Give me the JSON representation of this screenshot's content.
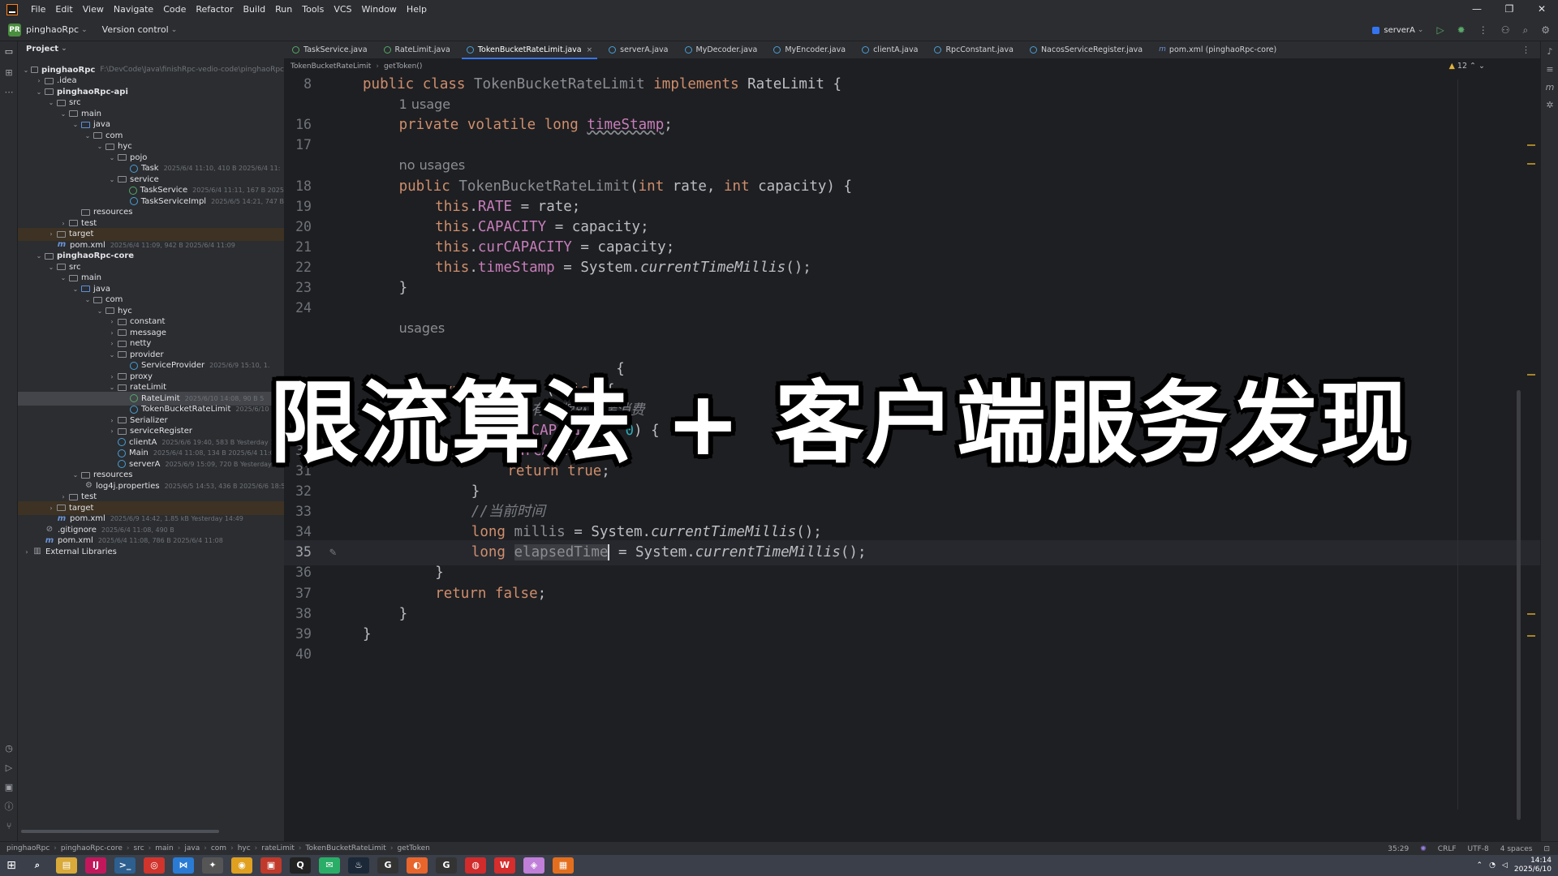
{
  "menu": [
    "File",
    "Edit",
    "View",
    "Navigate",
    "Code",
    "Refactor",
    "Build",
    "Run",
    "Tools",
    "VCS",
    "Window",
    "Help"
  ],
  "window_controls": {
    "minimize": "—",
    "maximize": "❐",
    "close": "✕"
  },
  "toolbar": {
    "project_badge": "PR",
    "project_name": "pinghaoRpc",
    "version_control": "Version control",
    "run_config": "serverA"
  },
  "project_panel": {
    "title": "Project",
    "tree": [
      {
        "label": "pinghaoRpc",
        "path": "F:\\DevCode\\Java\\finishRpc-vedio-code\\pinghaoRpc",
        "depth": 0,
        "arrow": "⌄",
        "icon": "folder",
        "bold": true
      },
      {
        "label": ".idea",
        "depth": 1,
        "arrow": "›",
        "icon": "folder"
      },
      {
        "label": "pinghaoRpc-api",
        "depth": 1,
        "arrow": "⌄",
        "icon": "folder",
        "bold": true
      },
      {
        "label": "src",
        "depth": 2,
        "arrow": "⌄",
        "icon": "folder"
      },
      {
        "label": "main",
        "depth": 3,
        "arrow": "⌄",
        "icon": "folder"
      },
      {
        "label": "java",
        "depth": 4,
        "arrow": "⌄",
        "icon": "folder src"
      },
      {
        "label": "com",
        "depth": 5,
        "arrow": "⌄",
        "icon": "folder"
      },
      {
        "label": "hyc",
        "depth": 6,
        "arrow": "⌄",
        "icon": "folder"
      },
      {
        "label": "pojo",
        "depth": 7,
        "arrow": "⌄",
        "icon": "folder"
      },
      {
        "label": "Task",
        "meta": "2025/6/4 11:10, 410 B 2025/6/4 11:",
        "depth": 8,
        "arrow": "",
        "icon": "cls"
      },
      {
        "label": "service",
        "depth": 7,
        "arrow": "⌄",
        "icon": "folder"
      },
      {
        "label": "TaskService",
        "meta": "2025/6/4 11:11, 167 B 2025",
        "depth": 8,
        "arrow": "",
        "icon": "iface"
      },
      {
        "label": "TaskServiceImpl",
        "meta": "2025/6/5 14:21, 747 B",
        "depth": 8,
        "arrow": "",
        "icon": "cls"
      },
      {
        "label": "resources",
        "depth": 4,
        "arrow": "",
        "icon": "folder"
      },
      {
        "label": "test",
        "depth": 3,
        "arrow": "›",
        "icon": "folder"
      },
      {
        "label": "target",
        "depth": 2,
        "arrow": "›",
        "icon": "folder",
        "hl": true
      },
      {
        "label": "pom.xml",
        "meta": "2025/6/4 11:09, 942 B 2025/6/4 11:09",
        "depth": 2,
        "arrow": "",
        "icon": "mvn"
      },
      {
        "label": "pinghaoRpc-core",
        "depth": 1,
        "arrow": "⌄",
        "icon": "folder",
        "bold": true
      },
      {
        "label": "src",
        "depth": 2,
        "arrow": "⌄",
        "icon": "folder"
      },
      {
        "label": "main",
        "depth": 3,
        "arrow": "⌄",
        "icon": "folder"
      },
      {
        "label": "java",
        "depth": 4,
        "arrow": "⌄",
        "icon": "folder src"
      },
      {
        "label": "com",
        "depth": 5,
        "arrow": "⌄",
        "icon": "folder"
      },
      {
        "label": "hyc",
        "depth": 6,
        "arrow": "⌄",
        "icon": "folder"
      },
      {
        "label": "constant",
        "depth": 7,
        "arrow": "›",
        "icon": "folder"
      },
      {
        "label": "message",
        "depth": 7,
        "arrow": "›",
        "icon": "folder"
      },
      {
        "label": "netty",
        "depth": 7,
        "arrow": "›",
        "icon": "folder"
      },
      {
        "label": "provider",
        "depth": 7,
        "arrow": "⌄",
        "icon": "folder"
      },
      {
        "label": "ServiceProvider",
        "meta": "2025/6/9 15:10, 1.",
        "depth": 8,
        "arrow": "",
        "icon": "cls"
      },
      {
        "label": "proxy",
        "depth": 7,
        "arrow": "›",
        "icon": "folder"
      },
      {
        "label": "rateLimit",
        "depth": 7,
        "arrow": "⌄",
        "icon": "folder"
      },
      {
        "label": "RateLimit",
        "meta": "2025/6/10 14:08, 90 B 5",
        "depth": 8,
        "arrow": "",
        "icon": "iface",
        "sel": true
      },
      {
        "label": "TokenBucketRateLimit",
        "meta": "2025/6/10 14:",
        "depth": 8,
        "arrow": "",
        "icon": "cls"
      },
      {
        "label": "Serializer",
        "depth": 7,
        "arrow": "›",
        "icon": "folder"
      },
      {
        "label": "serviceRegister",
        "depth": 7,
        "arrow": "›",
        "icon": "folder"
      },
      {
        "label": "clientA",
        "meta": "2025/6/6 19:40, 583 B Yesterday 14:",
        "depth": 7,
        "arrow": "",
        "icon": "cls"
      },
      {
        "label": "Main",
        "meta": "2025/6/4 11:08, 134 B 2025/6/4 11:09",
        "depth": 7,
        "arrow": "",
        "icon": "cls"
      },
      {
        "label": "serverA",
        "meta": "2025/6/9 15:09, 720 B Yesterday 15",
        "depth": 7,
        "arrow": "",
        "icon": "cls"
      },
      {
        "label": "resources",
        "depth": 4,
        "arrow": "⌄",
        "icon": "folder"
      },
      {
        "label": "log4j.properties",
        "meta": "2025/6/5 14:53, 436 B 2025/6/6 18:5",
        "depth": 5,
        "arrow": "",
        "icon": "gear"
      },
      {
        "label": "test",
        "depth": 3,
        "arrow": "›",
        "icon": "folder"
      },
      {
        "label": "target",
        "depth": 2,
        "arrow": "›",
        "icon": "folder",
        "hl": true
      },
      {
        "label": "pom.xml",
        "meta": "2025/6/9 14:42, 1.85 kB Yesterday 14:49",
        "depth": 2,
        "arrow": "",
        "icon": "mvn"
      },
      {
        "label": ".gitignore",
        "meta": "2025/6/4 11:08, 490 B",
        "depth": 1,
        "arrow": "",
        "icon": "ignore"
      },
      {
        "label": "pom.xml",
        "meta": "2025/6/4 11:08, 786 B 2025/6/4 11:08",
        "depth": 1,
        "arrow": "",
        "icon": "mvn"
      },
      {
        "label": "External Libraries",
        "depth": 0,
        "arrow": "›",
        "icon": "lib"
      }
    ]
  },
  "tabs": [
    {
      "label": "TaskService.java",
      "icon": "iface"
    },
    {
      "label": "RateLimit.java",
      "icon": "iface"
    },
    {
      "label": "TokenBucketRateLimit.java",
      "icon": "cls",
      "active": true
    },
    {
      "label": "serverA.java",
      "icon": "cls"
    },
    {
      "label": "MyDecoder.java",
      "icon": "cls"
    },
    {
      "label": "MyEncoder.java",
      "icon": "cls"
    },
    {
      "label": "clientA.java",
      "icon": "cls"
    },
    {
      "label": "RpcConstant.java",
      "icon": "cls"
    },
    {
      "label": "NacosServiceRegister.java",
      "icon": "cls"
    },
    {
      "label": "pom.xml (pinghaoRpc-core)",
      "icon": "m"
    }
  ],
  "editor_breadcrumb": [
    "TokenBucketRateLimit",
    "getToken()"
  ],
  "warning_count": "12",
  "code_lines": [
    {
      "n": "8",
      "html": "<span class=\"kw\">public class</span> <span class=\"grayname\">TokenBucketRateLimit</span> <span class=\"kw\">implements</span> RateLimit {",
      "indent": 0
    },
    {
      "n": "",
      "html": "<span class=\"hint\">1 usage</span>",
      "indent": 1
    },
    {
      "n": "16",
      "html": "<span class=\"kw\">private volatile long</span> <span class=\"fld und\">timeStamp</span>;",
      "indent": 1
    },
    {
      "n": "17",
      "html": "",
      "indent": 0
    },
    {
      "n": "",
      "html": "<span class=\"hint\">no usages</span>",
      "indent": 1
    },
    {
      "n": "18",
      "html": "<span class=\"kw\">public</span> <span class=\"grayname\">TokenBucketRateLimit</span>(<span class=\"kw\">int</span> rate, <span class=\"kw\">int</span> capacity) {",
      "indent": 1
    },
    {
      "n": "19",
      "html": "<span class=\"kw\">this</span>.<span class=\"fld\">RATE</span> = rate;",
      "indent": 2
    },
    {
      "n": "20",
      "html": "<span class=\"kw\">this</span>.<span class=\"fld\">CAPACITY</span> = capacity;",
      "indent": 2
    },
    {
      "n": "21",
      "html": "<span class=\"kw\">this</span>.<span class=\"fld\">curCAPACITY</span> = capacity;",
      "indent": 2
    },
    {
      "n": "22",
      "html": "<span class=\"kw\">this</span>.<span class=\"fld\">timeStamp</span> = System.<span class=\"it\">currentTimeMillis</span>();",
      "indent": 2
    },
    {
      "n": "23",
      "html": "}",
      "indent": 1
    },
    {
      "n": "24",
      "html": "",
      "indent": 0
    },
    {
      "n": "",
      "html": "<span class=\"hint\">usages</span>",
      "indent": 1
    },
    {
      "n": "",
      "html": "",
      "indent": 0
    },
    {
      "n": "",
      "html": "{",
      "indent": 7
    },
    {
      "n": "27",
      "html": "<span class=\"kw\">synchronized</span> (<span class=\"kw\">this</span>) {",
      "indent": 2
    },
    {
      "n": "28",
      "html": "<span class=\"cmt\">//桶里还有令牌就直接消费</span>",
      "indent": 3
    },
    {
      "n": "29",
      "html": "<span class=\"kw\">if</span> (<span class=\"fld\">curCAPACITY</span> &gt; <span class=\"num\">0</span>) {",
      "indent": 3
    },
    {
      "n": "30",
      "html": "<span class=\"fld\">curCAPACITY</span>--;",
      "indent": 4
    },
    {
      "n": "31",
      "html": "<span class=\"kw\">return true</span>;",
      "indent": 4
    },
    {
      "n": "32",
      "html": "}",
      "indent": 3
    },
    {
      "n": "33",
      "html": "<span class=\"cmt\">//当前时间</span>",
      "indent": 3
    },
    {
      "n": "34",
      "html": "<span class=\"kw\">long</span> <span class=\"grayname\">millis</span> = System.<span class=\"it\">currentTimeMillis</span>();",
      "indent": 3
    },
    {
      "n": "35",
      "html": "<span class=\"kw\">long</span> <span class=\"grayname\" style=\"background:#3b3d42\">elapsedTime</span><span class=\"caret\"></span> = System.<span class=\"it\">currentTimeMillis</span>();",
      "indent": 3,
      "cur": true
    },
    {
      "n": "36",
      "html": "}",
      "indent": 2
    },
    {
      "n": "37",
      "html": "<span class=\"kw\">return false</span>;",
      "indent": 2
    },
    {
      "n": "38",
      "html": "}",
      "indent": 1
    },
    {
      "n": "39",
      "html": "}",
      "indent": 0
    },
    {
      "n": "40",
      "html": "",
      "indent": 0
    }
  ],
  "overlay_title": "限流算法 + 客户端服务发现",
  "status_bar": {
    "crumbs": [
      "pinghaoRpc",
      "pinghaoRpc-core",
      "src",
      "main",
      "java",
      "com",
      "hyc",
      "rateLimit",
      "TokenBucketRateLimit",
      "getToken"
    ],
    "position": "35:29",
    "line_sep": "CRLF",
    "encoding": "UTF-8",
    "indent": "4 spaces"
  },
  "taskbar": {
    "apps": [
      {
        "name": "search",
        "color": "#3a3f4a",
        "glyph": "⌕"
      },
      {
        "name": "files",
        "color": "#d9a93a",
        "glyph": "▤"
      },
      {
        "name": "intellij",
        "color": "#c2185b",
        "glyph": "IJ"
      },
      {
        "name": "terminal",
        "color": "#2d5f8f",
        "glyph": ">_"
      },
      {
        "name": "app-red",
        "color": "#d0342c",
        "glyph": "◎"
      },
      {
        "name": "vscode",
        "color": "#2a7bd4",
        "glyph": "⋈"
      },
      {
        "name": "app-gray",
        "color": "#555",
        "glyph": "✦"
      },
      {
        "name": "chrome",
        "color": "#e0a020",
        "glyph": "◉"
      },
      {
        "name": "app-red2",
        "color": "#c0392b",
        "glyph": "▣"
      },
      {
        "name": "qq",
        "color": "#222",
        "glyph": "Q"
      },
      {
        "name": "wechat",
        "color": "#2aae67",
        "glyph": "✉"
      },
      {
        "name": "steam",
        "color": "#1b2838",
        "glyph": "♨"
      },
      {
        "name": "app-dark",
        "color": "#333",
        "glyph": "G"
      },
      {
        "name": "firefox",
        "color": "#e8662c",
        "glyph": "◐"
      },
      {
        "name": "app-g",
        "color": "#333",
        "glyph": "G"
      },
      {
        "name": "netease",
        "color": "#d12b2b",
        "glyph": "◍"
      },
      {
        "name": "wps",
        "color": "#d62d2d",
        "glyph": "W"
      },
      {
        "name": "app-pink",
        "color": "#c07fd8",
        "glyph": "◈"
      },
      {
        "name": "app-orange",
        "color": "#e36f1e",
        "glyph": "▦"
      }
    ],
    "time": "14:14",
    "date": "2025/6/10"
  },
  "colors": {
    "accent": "#3574f0",
    "keyword": "#cf8e6d",
    "field": "#c77dbb",
    "number": "#2aacb8"
  }
}
